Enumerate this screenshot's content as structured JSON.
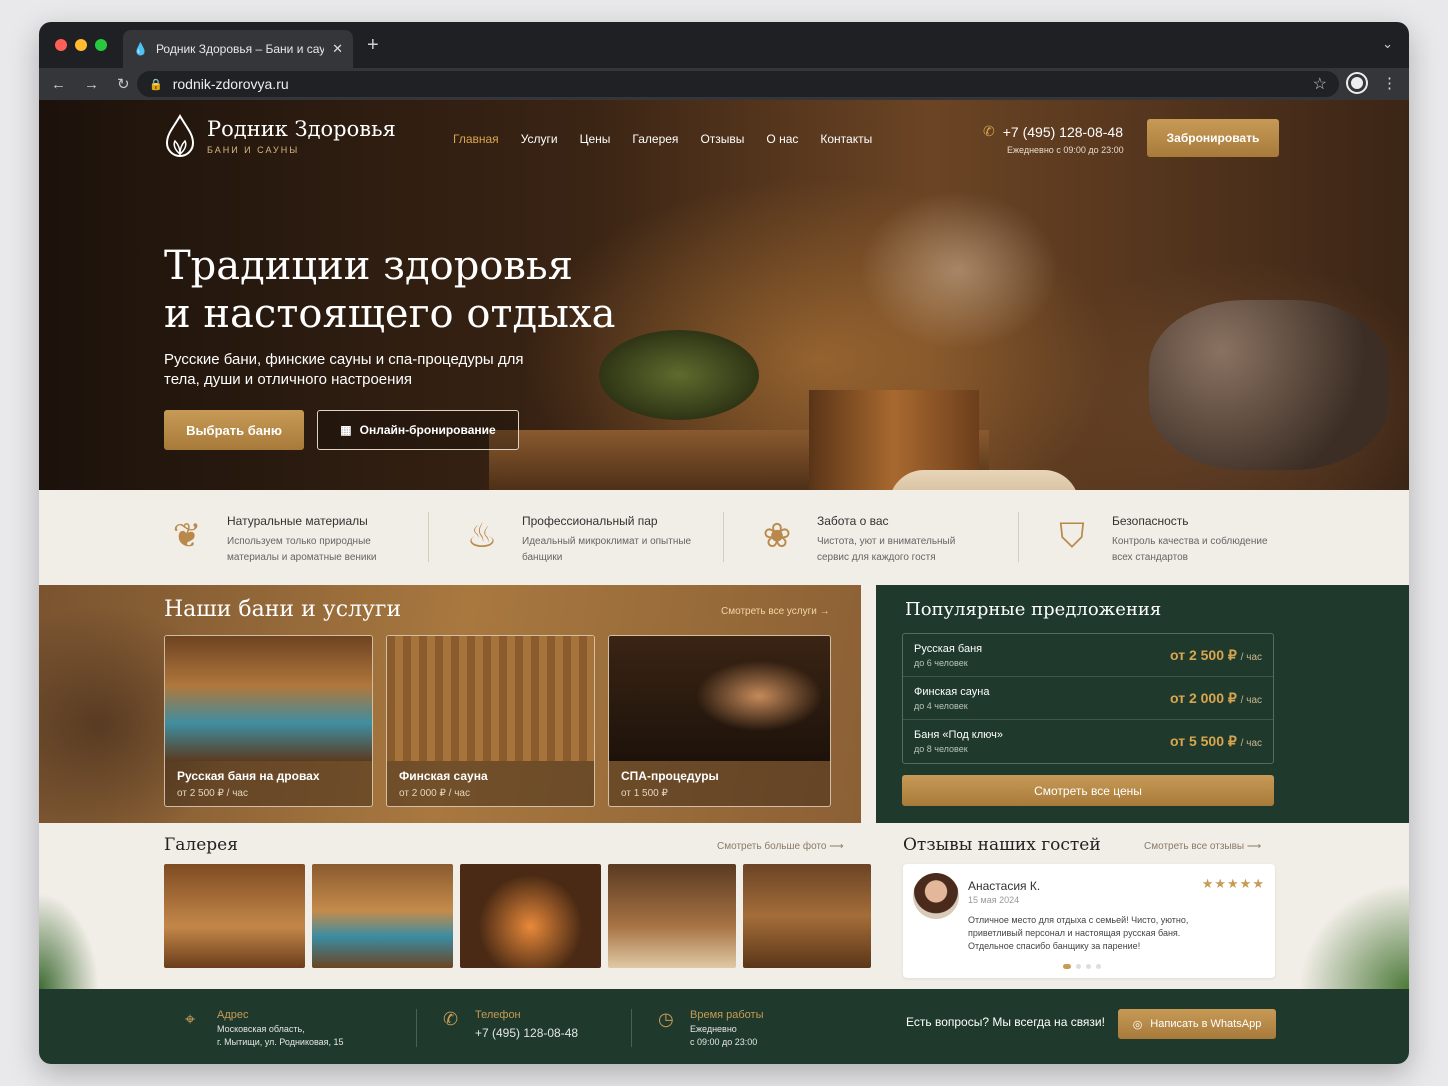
{
  "browser": {
    "tab_title": "Родник Здоровья – Бани и сауны",
    "url": "rodnik-zdorovya.ru"
  },
  "brand": {
    "name": "Родник Здоровья",
    "tagline": "БАНИ И САУНЫ"
  },
  "nav": {
    "items": [
      "Главная",
      "Услуги",
      "Цены",
      "Галерея",
      "Отзывы",
      "О нас",
      "Контакты"
    ]
  },
  "contact": {
    "phone": "+7 (495) 128-08-48",
    "hours": "Ежедневно с 09:00 до 23:00",
    "book_label": "Забронировать"
  },
  "hero": {
    "title_line1": "Традиции здоровья",
    "title_line2": "и настоящего отдыха",
    "subtitle": "Русские бани, финские сауны и спа-процедуры для тела, души и отличного настроения",
    "primary_cta": "Выбрать баню",
    "secondary_cta": "Онлайн-бронирование"
  },
  "features": [
    {
      "title": "Натуральные материалы",
      "desc": "Используем только природные материалы и ароматные веники",
      "icon": "leaf-icon"
    },
    {
      "title": "Профессиональный пар",
      "desc": "Идеальный микроклимат и опытные банщики",
      "icon": "steam-icon"
    },
    {
      "title": "Забота о вас",
      "desc": "Чистота, уют и внимательный сервис для каждого гостя",
      "icon": "lotus-icon"
    },
    {
      "title": "Безопасность",
      "desc": "Контроль качества и соблюдение всех стандартов",
      "icon": "shield-icon"
    }
  ],
  "services": {
    "title": "Наши бани и услуги",
    "more_label": "Смотреть все услуги →",
    "cards": [
      {
        "title": "Русская баня на дровах",
        "price": "от 2 500 ₽ / час"
      },
      {
        "title": "Финская сауна",
        "price": "от 2 000 ₽ / час"
      },
      {
        "title": "СПА-процедуры",
        "price": "от 1 500 ₽"
      }
    ]
  },
  "offers": {
    "title": "Популярные предложения",
    "items": [
      {
        "name": "Русская баня",
        "guests": "до 6 человек",
        "price": "от 2 500 ₽",
        "unit": "/ час"
      },
      {
        "name": "Финская сауна",
        "guests": "до 4 человек",
        "price": "от 2 000 ₽",
        "unit": "/ час"
      },
      {
        "name": "Баня «Под ключ»",
        "guests": "до 8 человек",
        "price": "от 5 500 ₽",
        "unit": "/ час"
      }
    ],
    "all_label": "Смотреть все цены"
  },
  "gallery": {
    "title": "Галерея",
    "more_label": "Смотреть больше фото ⟶"
  },
  "reviews": {
    "title": "Отзывы наших гостей",
    "more_label": "Смотреть все отзывы ⟶",
    "item": {
      "name": "Анастасия К.",
      "date": "15 мая 2024",
      "stars": "★★★★★",
      "text": "Отличное место для отдыха с семьей! Чисто, уютно, приветливый персонал и настоящая русская баня. Отдельное спасибо банщику за парение!"
    }
  },
  "footer": {
    "address_label": "Адрес",
    "address_line1": "Московская область,",
    "address_line2": "г. Мытищи, ул. Родниковая, 15",
    "phone_label": "Телефон",
    "phone": "+7 (495) 128-08-48",
    "hours_label": "Время работы",
    "hours_line1": "Ежедневно",
    "hours_line2": "с 09:00 до 23:00",
    "question": "Есть вопросы? Мы всегда на связи!",
    "whatsapp_label": "Написать в WhatsApp"
  },
  "colors": {
    "accent_gold": "#c79b56",
    "forest_green": "#1f3a2c",
    "active_nav": "#d9a64f"
  }
}
